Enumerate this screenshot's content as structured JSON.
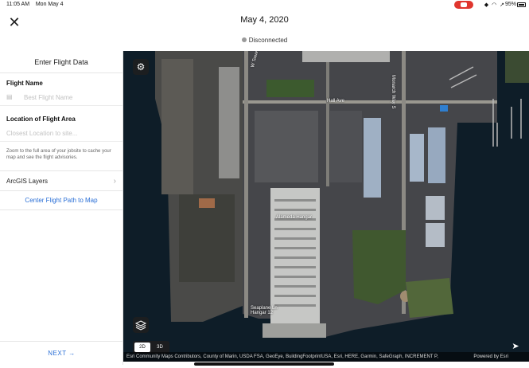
{
  "status_bar": {
    "time": "11:05 AM",
    "date": "Mon May 4",
    "battery": "95%"
  },
  "header": {
    "title": "May 4, 2020",
    "connection_status": "Disconnected",
    "close_icon": "close-icon"
  },
  "panel": {
    "title": "Enter Flight Data",
    "flight_name": {
      "label": "Flight Name",
      "placeholder": "Best Flight Name",
      "value": ""
    },
    "location": {
      "label": "Location of Flight Area",
      "placeholder": "Closest Location to site...",
      "value": "",
      "hint": "Zoom to the full area of your jobsite to cache your map and see the flight advisories."
    },
    "arcgis_layers": "ArcGIS Layers",
    "center_link": "Center Flight Path to Map",
    "next_label": "NEXT →"
  },
  "map": {
    "street_labels": [
      "Hall Ave",
      "Monarch Way S",
      "W Tower Ave",
      "Seaplane Ln"
    ],
    "building_labels": [
      "Alameda Hangar",
      "Hangar 12"
    ],
    "view_mode": {
      "options": [
        "2D",
        "3D"
      ],
      "selected": "2D"
    },
    "attribution": "Esri Community Maps Contributors, County of Marin, USDA FSA, GeoEye, BuildingFootprintUSA, Esri, HERE, Garmin, SafeGraph, INCREMENT P,",
    "powered_by": "Powered by Esri"
  },
  "colors": {
    "accent": "#2a6fd6",
    "water": "#0c1a24",
    "record": "#e0362e"
  }
}
